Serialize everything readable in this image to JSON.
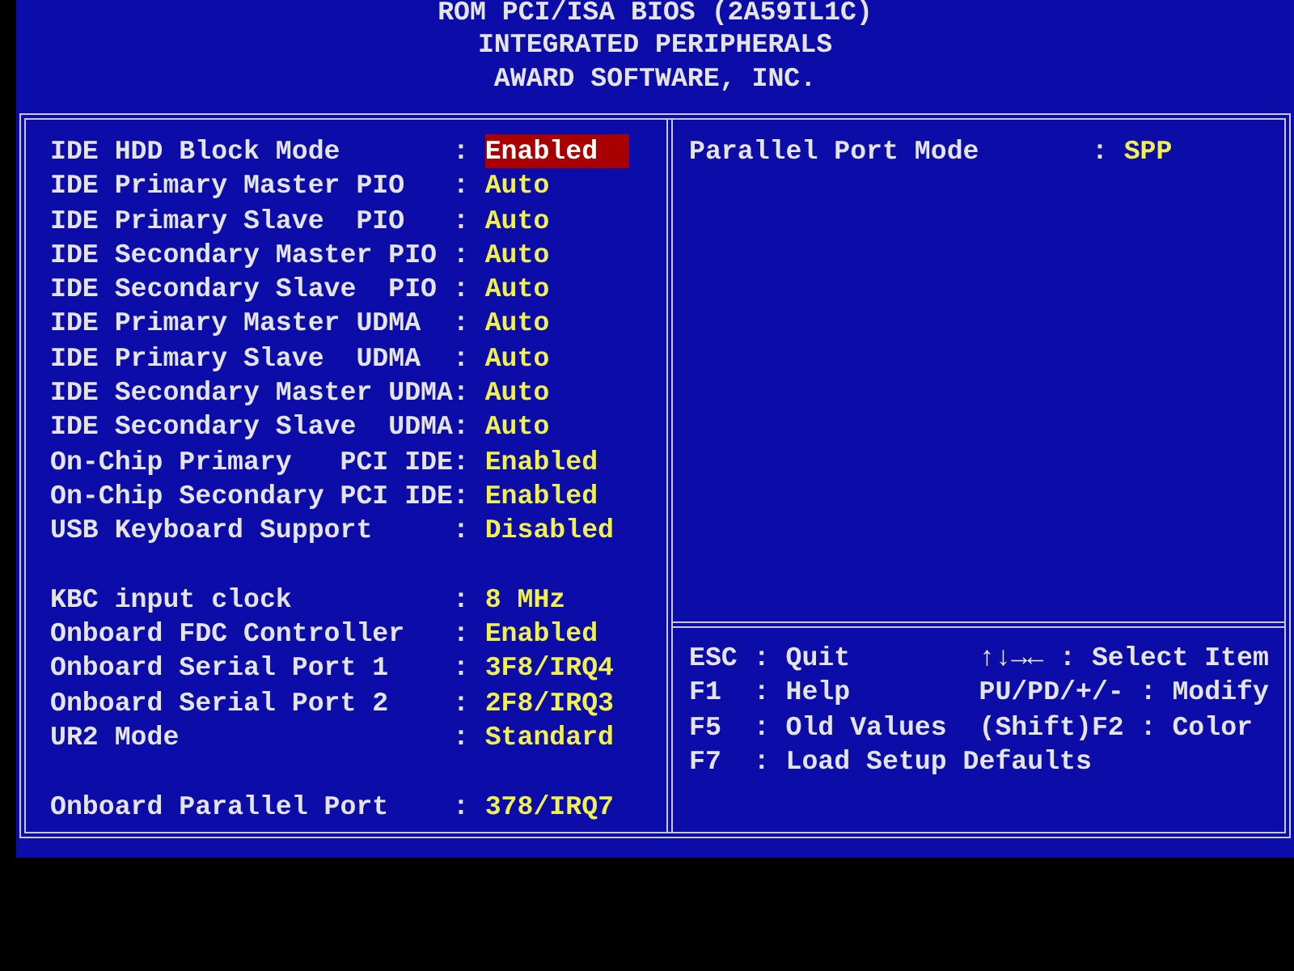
{
  "header": [
    "ROM PCI/ISA BIOS (2A59IL1C)",
    "INTEGRATED PERIPHERALS",
    "AWARD SOFTWARE, INC."
  ],
  "left_panel": {
    "groups": [
      {
        "items": [
          {
            "label": "IDE HDD Block Mode",
            "sep": ":",
            "value": "Enabled",
            "selected": true
          },
          {
            "label": "IDE Primary Master PIO",
            "sep": ":",
            "value": "Auto",
            "selected": false
          },
          {
            "label": "IDE Primary Slave  PIO",
            "sep": ":",
            "value": "Auto",
            "selected": false
          },
          {
            "label": "IDE Secondary Master PIO",
            "sep": ":",
            "value": "Auto",
            "selected": false
          },
          {
            "label": "IDE Secondary Slave  PIO",
            "sep": ":",
            "value": "Auto",
            "selected": false
          },
          {
            "label": "IDE Primary Master UDMA",
            "sep": ":",
            "value": "Auto",
            "selected": false
          },
          {
            "label": "IDE Primary Slave  UDMA",
            "sep": ":",
            "value": "Auto",
            "selected": false
          },
          {
            "label": "IDE Secondary Master UDMA",
            "sep": ":",
            "value": "Auto",
            "selected": false
          },
          {
            "label": "IDE Secondary Slave  UDMA",
            "sep": ":",
            "value": "Auto",
            "selected": false
          },
          {
            "label": "On-Chip Primary   PCI IDE",
            "sep": ":",
            "value": "Enabled",
            "selected": false
          },
          {
            "label": "On-Chip Secondary PCI IDE",
            "sep": ":",
            "value": "Enabled",
            "selected": false
          },
          {
            "label": "USB Keyboard Support",
            "sep": ":",
            "value": "Disabled",
            "selected": false
          }
        ]
      },
      {
        "items": [
          {
            "label": "KBC input clock",
            "sep": ":",
            "value": "8 MHz",
            "selected": false
          },
          {
            "label": "Onboard FDC Controller",
            "sep": ":",
            "value": "Enabled",
            "selected": false
          },
          {
            "label": "Onboard Serial Port 1",
            "sep": ":",
            "value": "3F8/IRQ4",
            "selected": false
          },
          {
            "label": "Onboard Serial Port 2",
            "sep": ":",
            "value": "2F8/IRQ3",
            "selected": false
          },
          {
            "label": "UR2 Mode",
            "sep": ":",
            "value": "Standard",
            "selected": false
          }
        ]
      },
      {
        "items": [
          {
            "label": "Onboard Parallel Port",
            "sep": ":",
            "value": "378/IRQ7",
            "selected": false
          }
        ]
      }
    ]
  },
  "right_panel": {
    "settings": [
      {
        "label": "Parallel Port Mode",
        "sep": ":",
        "value": "SPP",
        "selected": false
      }
    ]
  },
  "help": {
    "left": [
      "ESC : Quit",
      "F1  : Help",
      "F5  : Old Values",
      "F7  : Load Setup Defaults"
    ],
    "right": [
      "↑↓→← : Select Item",
      "PU/PD/+/- : Modify",
      "(Shift)F2 : Color"
    ]
  }
}
